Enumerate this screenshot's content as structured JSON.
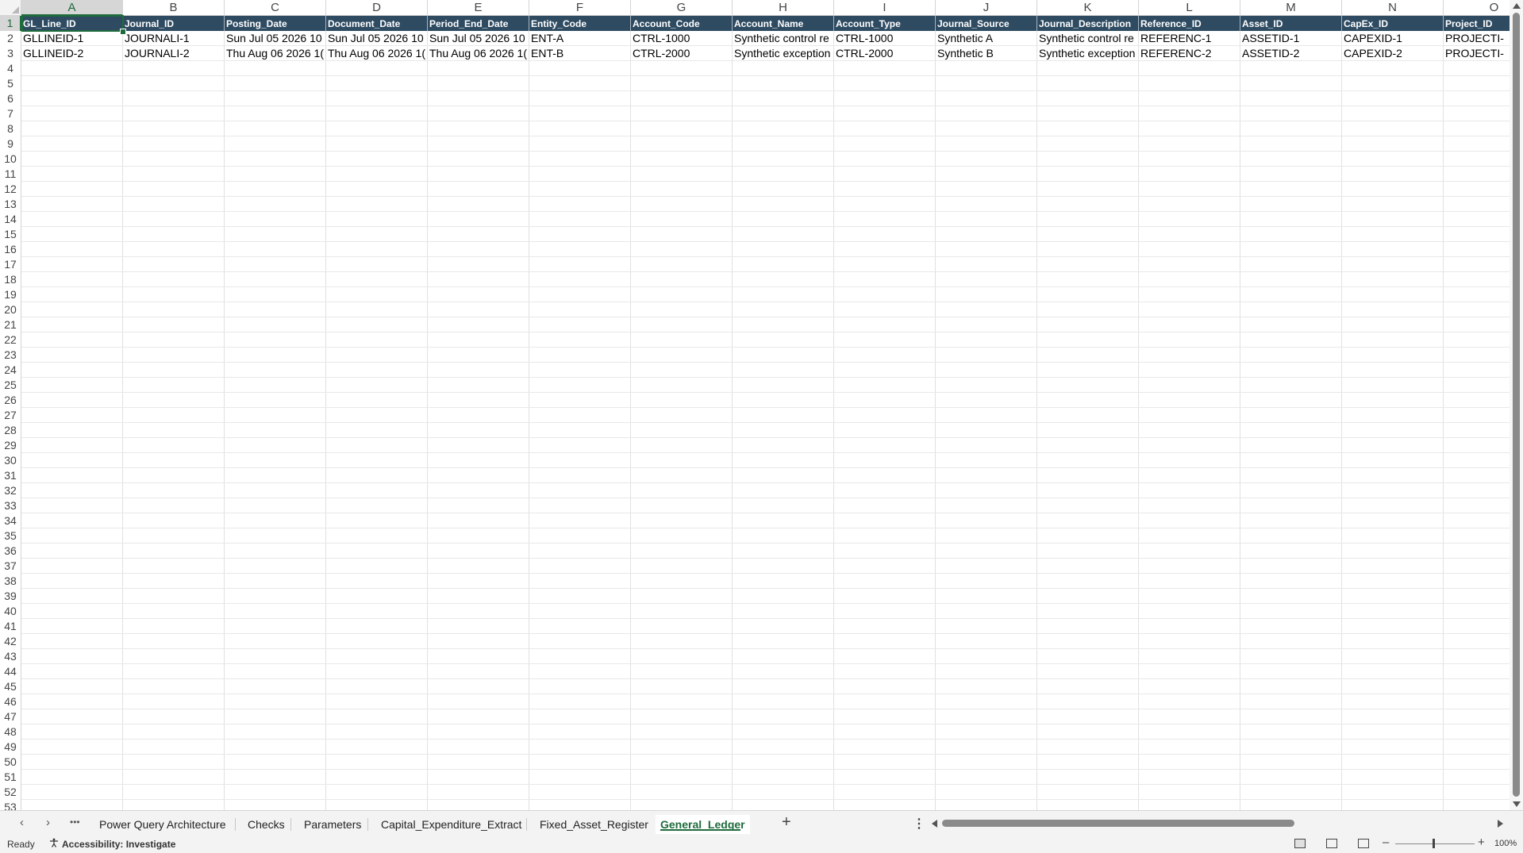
{
  "sheet": {
    "column_letters": [
      "A",
      "B",
      "C",
      "D",
      "E",
      "F",
      "G",
      "H",
      "I",
      "J",
      "K",
      "L",
      "M",
      "N",
      "O"
    ],
    "row_numbers": [
      "1",
      "2",
      "3",
      "4",
      "5",
      "6",
      "7",
      "8",
      "9",
      "10",
      "11",
      "12",
      "13",
      "14",
      "15",
      "16",
      "17",
      "18",
      "19",
      "20",
      "21",
      "22",
      "23",
      "24",
      "25",
      "26",
      "27",
      "28",
      "29",
      "30",
      "31",
      "32",
      "33",
      "34",
      "35",
      "36",
      "37",
      "38",
      "39",
      "40",
      "41",
      "42",
      "43",
      "44",
      "45",
      "46",
      "47",
      "48",
      "49",
      "50",
      "51",
      "52",
      "53"
    ],
    "selected_cell": "A1",
    "headers": [
      "GL_Line_ID",
      "Journal_ID",
      "Posting_Date",
      "Document_Date",
      "Period_End_Date",
      "Entity_Code",
      "Account_Code",
      "Account_Name",
      "Account_Type",
      "Journal_Source",
      "Journal_Description",
      "Reference_ID",
      "Asset_ID",
      "CapEx_ID",
      "Project_ID"
    ],
    "rows": [
      [
        "GLLINEID-1",
        "JOURNALI-1",
        "Sun Jul 05 2026 10",
        "Sun Jul 05 2026 10",
        "Sun Jul 05 2026 10",
        "ENT-A",
        "CTRL-1000",
        "Synthetic control re",
        "CTRL-1000",
        "Synthetic A",
        "Synthetic control re",
        "REFERENC-1",
        "ASSETID-1",
        "CAPEXID-1",
        "PROJECTI-"
      ],
      [
        "GLLINEID-2",
        "JOURNALI-2",
        "Thu Aug 06 2026 1(",
        "Thu Aug 06 2026 1(",
        "Thu Aug 06 2026 1(",
        "ENT-B",
        "CTRL-2000",
        "Synthetic exception",
        "CTRL-2000",
        "Synthetic B",
        "Synthetic exception",
        "REFERENC-2",
        "ASSETID-2",
        "CAPEXID-2",
        "PROJECTI-"
      ]
    ],
    "header_fill_color": "#2e4b62"
  },
  "tabs": {
    "ellipsis": "•••",
    "items": [
      "Power Query Architecture",
      "Checks",
      "Parameters",
      "Capital_Expenditure_Extract",
      "Fixed_Asset_Register",
      "General_Ledger"
    ],
    "active": "General_Ledger",
    "add_label": "+",
    "more_label": "⋮"
  },
  "status": {
    "ready": "Ready",
    "accessibility": "Accessibility: Investigate",
    "zoom": "100%",
    "zoom_minus": "–",
    "zoom_plus": "+"
  },
  "icons": {
    "accessibility": "accessibility-icon",
    "normal_view": "normal-view-icon",
    "page_layout_view": "page-layout-view-icon",
    "page_break_view": "page-break-view-icon"
  },
  "accent_color": "#1e6b3c"
}
